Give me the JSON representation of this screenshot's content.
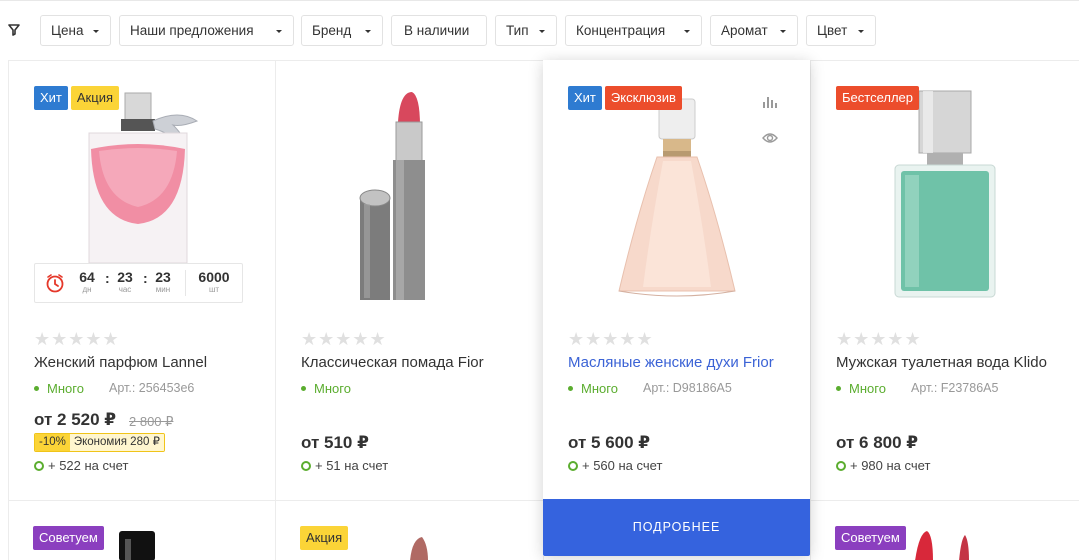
{
  "filters": {
    "items": [
      {
        "label": "Цена"
      },
      {
        "label": "Наши предложения"
      },
      {
        "label": "Бренд"
      },
      {
        "label": "В наличии"
      },
      {
        "label": "Тип"
      },
      {
        "label": "Концентрация"
      },
      {
        "label": "Аромат"
      },
      {
        "label": "Цвет"
      }
    ]
  },
  "colors": {
    "accent_blue": "#3563de",
    "link_blue": "#3b63d6",
    "in_stock_green": "#5bad2f",
    "badge_hit": "#2e7bd1",
    "badge_sale": "#fbd437",
    "badge_exclusive": "#ec4d2c",
    "badge_recommend": "#8b3fbf"
  },
  "products": [
    {
      "badges": [
        "Хит",
        "Акция"
      ],
      "name": "Женский парфюм Lannel",
      "stock": "Много",
      "article": "Арт.: 256453е6",
      "price": "от 2 520 ₽",
      "old_price": "2 800 ₽",
      "discount_pct": "-10%",
      "discount_save": "Экономия 280 ₽",
      "bonus": "+ 522 на счет",
      "timer": {
        "days": "64",
        "days_unit": "дн",
        "hours": "23",
        "hours_unit": "час",
        "minutes": "23",
        "minutes_unit": "мин",
        "count": "6000",
        "count_unit": "шт"
      }
    },
    {
      "badges": [],
      "name": "Классическая помада Fior",
      "stock": "Много",
      "price": "от 510 ₽",
      "bonus": "+ 51 на счет"
    },
    {
      "badges": [
        "Хит",
        "Эксклюзив"
      ],
      "name": "Масляные женские духи Frior",
      "stock": "Много",
      "article": "Арт.: D98186A5",
      "price": "от 5 600 ₽",
      "bonus": "+ 560 на счет",
      "button": "ПОДРОБНЕЕ"
    },
    {
      "badges": [
        "Бестселлер"
      ],
      "name": "Мужская туалетная вода Klido",
      "stock": "Много",
      "article": "Арт.: F23786A5",
      "price": "от 6 800 ₽",
      "bonus": "+ 980 на счет"
    }
  ],
  "bottom_badges": [
    "Советуем",
    "Акция",
    "Советуем"
  ],
  "rating_stars": "★★★★★"
}
